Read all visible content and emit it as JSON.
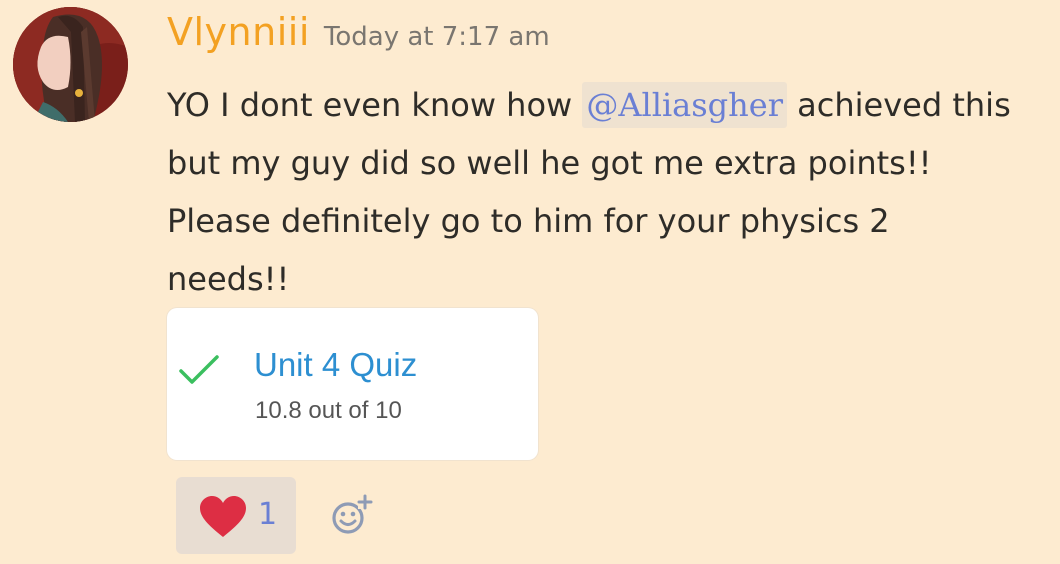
{
  "message": {
    "username": "Vlynniii",
    "timestamp": "Today at 7:17 am",
    "lines": [
      {
        "before": "YO I dont even know how ",
        "mention": "@Alliasgher",
        "after": " achieved this"
      },
      "but my guy did so well he got me extra points!!",
      "Please definitely go to him for your physics 2",
      "needs!!"
    ]
  },
  "attachment": {
    "title": "Unit 4 Quiz",
    "score": "10.8 out of 10",
    "icon": "check-icon"
  },
  "reactions": [
    {
      "icon": "heart-icon",
      "count": "1"
    }
  ],
  "colors": {
    "background": "#fdebd0",
    "username": "#f3a122",
    "mention": "#6a7fd4",
    "quiz_title": "#2d8fd1",
    "check": "#3bbf5f",
    "heart": "#dd2e44"
  }
}
